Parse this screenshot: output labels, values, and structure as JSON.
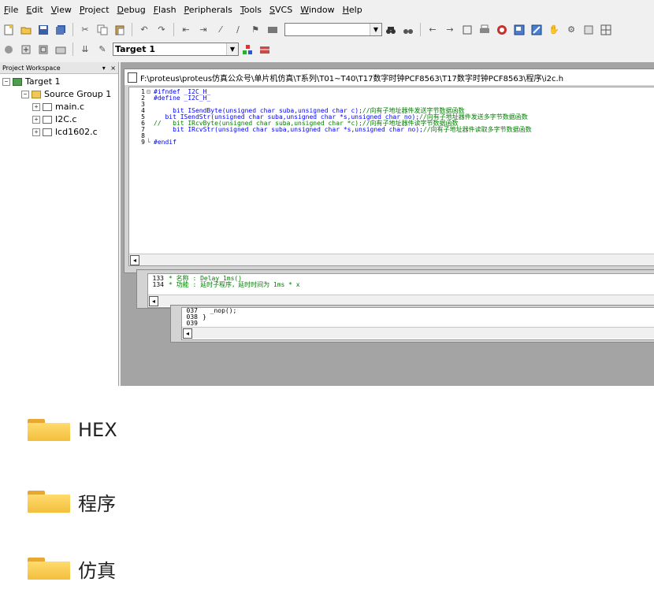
{
  "menu": [
    "File",
    "Edit",
    "View",
    "Project",
    "Debug",
    "Flash",
    "Peripherals",
    "Tools",
    "SVCS",
    "Window",
    "Help"
  ],
  "toolbar": {
    "target_combo": "Target 1",
    "find_combo": ""
  },
  "workspace": {
    "title": "Project Workspace",
    "pin": "▾",
    "close": "×",
    "tree": {
      "target": "Target 1",
      "group": "Source Group 1",
      "files": [
        "main.c",
        "I2C.c",
        "lcd1602.c"
      ]
    }
  },
  "editor": {
    "title": "F:\\proteus\\proteus仿真公众号\\单片机仿真\\T系列\\T01~T40\\T17数字时钟PCF8563\\T17数字时钟PCF8563\\程序\\i2c.h",
    "lines": [
      {
        "n": "1",
        "fold": "⊟",
        "pre": "#ifndef _I2C_H_",
        "cmt": ""
      },
      {
        "n": "2",
        "fold": "",
        "pre": "#define _I2C_H_",
        "cmt": ""
      },
      {
        "n": "3",
        "fold": "",
        "pre": "",
        "cmt": ""
      },
      {
        "n": "4",
        "fold": "",
        "pre": "     bit ISendByte(unsigned char suba,unsigned char c);",
        "cmt": "//向有子地址器件发送字节数据函数"
      },
      {
        "n": "5",
        "fold": "",
        "pre": "   bit ISendStr(unsigned char suba,unsigned char *s,unsigned char no);",
        "cmt": "//向有子地址器件发送多字节数据函数"
      },
      {
        "n": "6",
        "fold": "",
        "pre": "",
        "cmt": "//   bit IRcvByte(unsigned char suba,unsigned char *c);//向有子地址器件读字节数据函数"
      },
      {
        "n": "7",
        "fold": "",
        "pre": "     bit IRcvStr(unsigned char suba,unsigned char *s,unsigned char no);",
        "cmt": "//向有子地址器件读取多字节数据函数"
      },
      {
        "n": "8",
        "fold": "",
        "pre": "",
        "cmt": ""
      },
      {
        "n": "9",
        "fold": "└",
        "pre": "#endif",
        "cmt": ""
      }
    ]
  },
  "editor2": {
    "lines": [
      {
        "n": "133",
        "text": "* 名称 : Delay_1ms()"
      },
      {
        "n": "134",
        "text": "* 功能 : 延时子程序，延时时间为 1ms * x"
      }
    ]
  },
  "editor3": {
    "lines": [
      {
        "n": "037",
        "text": "  _nop();"
      },
      {
        "n": "038",
        "text": "}"
      },
      {
        "n": "039",
        "text": ""
      }
    ]
  },
  "folders": [
    {
      "name": "HEX"
    },
    {
      "name": "程序"
    },
    {
      "name": "仿真"
    }
  ],
  "scroll_left": "◂",
  "colors": {
    "folder": "#f3bf3c",
    "comment": "#008000",
    "keyword": "#0000ff"
  }
}
